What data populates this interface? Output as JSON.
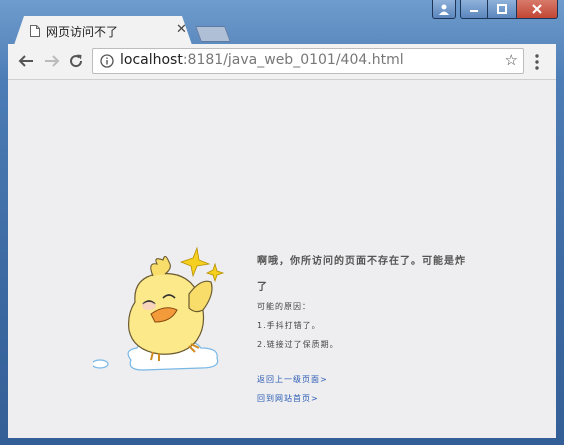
{
  "browser": {
    "tab_title": "网页访问不了",
    "url_host": "localhost",
    "url_path": ":8181/java_web_0101/404.html"
  },
  "icons": [
    "page-icon",
    "close-icon",
    "back-arrow-icon",
    "forward-arrow-icon",
    "reload-icon",
    "info-icon",
    "star-icon",
    "menu-dots-icon",
    "user-icon",
    "minimize-icon",
    "maximize-icon"
  ],
  "error_page": {
    "title": "啊哦，你所访问的页面不存在了。可能是炸了",
    "reasons_label": "可能的原因：",
    "reasons": [
      "1.手抖打错了。",
      "2.链接过了保质期。"
    ],
    "links": [
      "返回上一级页面>",
      "回到网站首页>"
    ]
  },
  "colors": {
    "link": "#2a5bb3",
    "content_bg": "#eeeef0",
    "chick_body": "#fbe98a",
    "chick_beak": "#f39a3a"
  }
}
